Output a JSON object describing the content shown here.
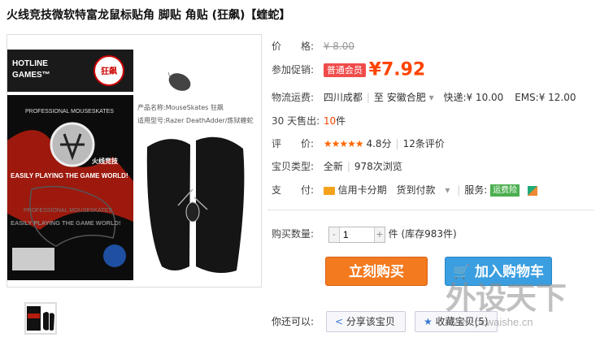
{
  "title": "火线竞技微软特富龙鼠标贴角 脚贴 角贴 (狂飙)【蝰蛇】",
  "product_image": {
    "hotline_text": "HOTLINE\nGAMES™",
    "brand_stamp": "狂飙",
    "pro_text": "PROFESSIONAL MOUSESKATES",
    "chinese_brand": "火线竞技",
    "easily_text": "EASILY PLAYING THE GAME WORLD!",
    "product_name_line": "产品名称:MouseSkates 狂飙",
    "model_line": "适用型号:Razer DeathAdder/炼狱蝰蛇"
  },
  "price": {
    "label": "价　　格:",
    "value": "¥ 8.00"
  },
  "promo": {
    "label": "参加促销:",
    "badge": "普通会员",
    "value": "¥7.92"
  },
  "shipping": {
    "label": "物流运费:",
    "from": "四川成都",
    "to_prefix": "至",
    "to": "安徽合肥",
    "express": "快递:¥ 10.00",
    "ems": "EMS:¥ 12.00"
  },
  "sales": {
    "label": "30 天售出:",
    "count": "10",
    "unit": "件"
  },
  "rating": {
    "label": "评　　价:",
    "stars": "★★★★★",
    "score": "4.8分",
    "reviews": "12条评价"
  },
  "item_type": {
    "label": "宝贝类型:",
    "condition": "全新",
    "views": "978次浏览"
  },
  "payment": {
    "label": "支　　付:",
    "credit": "信用卡分期",
    "cod": "货到付款",
    "service_label": "服务:",
    "service_badge": "运费险"
  },
  "quantity": {
    "label": "购买数量:",
    "value": "1",
    "stock": "件 (库存983件)"
  },
  "buttons": {
    "buy_now": "立刻购买",
    "add_cart": "加入购物车"
  },
  "share": {
    "label": "你还可以:",
    "share_item": "分享该宝贝",
    "favorite": "收藏宝贝(5)"
  },
  "watermark": {
    "brand": "外设天下",
    "url": "www.pcwaishe.cn"
  }
}
